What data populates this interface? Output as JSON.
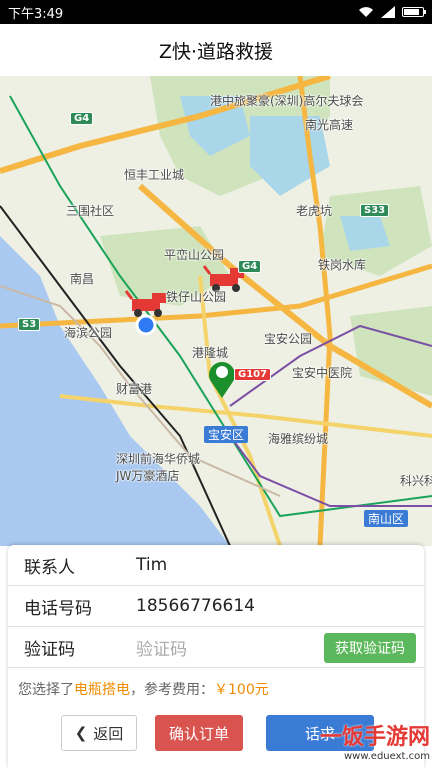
{
  "status": {
    "time": "下午3:49",
    "battery_level": 0.85
  },
  "header": {
    "title": "Z快·道路救援"
  },
  "map": {
    "labels": {
      "huijiang": "港中旅聚豪(深圳)高尔夫球会",
      "nanguang": "南光高速",
      "hengfeng": "恒丰工业城",
      "sanwei": "三围社区",
      "laohukeng": "老虎坑",
      "pingluan": "平峦山公园",
      "tiegang": "铁岗水库",
      "nanchang": "南昌",
      "tiezai": "铁仔山公园",
      "haibin": "海滨公园",
      "baoan_park": "宝安公园",
      "ganglong": "港隆城",
      "baoan_hosp": "宝安中医院",
      "fuhaigang": "财富港",
      "haiya": "海雅缤纷城",
      "qianhai": "深圳前海华侨城JW万豪酒店",
      "kefa": "科兴科",
      "nanshan": "南山区",
      "baoan": "宝安区"
    },
    "shields": {
      "g4_top": "G4",
      "g4_mid": "G4",
      "s33": "S33",
      "s3": "S3",
      "g107": "G107"
    }
  },
  "form": {
    "contact_label": "联系人",
    "contact_value": "Tim",
    "phone_label": "电话号码",
    "phone_value": "18566776614",
    "code_label": "验证码",
    "code_placeholder": "验证码",
    "get_code_btn": "获取验证码",
    "info_prefix": "您选择了",
    "service": "电瓶搭电",
    "info_mid": "，参考费用：",
    "price": "￥100元",
    "back_btn": "返回",
    "confirm_btn": "确认订单",
    "call_btn": "话求"
  },
  "watermark": {
    "main": "一饭手游网",
    "sub": "www.eduext.com"
  },
  "colors": {
    "accent_green": "#5cb85c",
    "confirm_red": "#d9534f",
    "call_blue": "#3a7bd5",
    "highlight_orange": "#f08c00"
  }
}
